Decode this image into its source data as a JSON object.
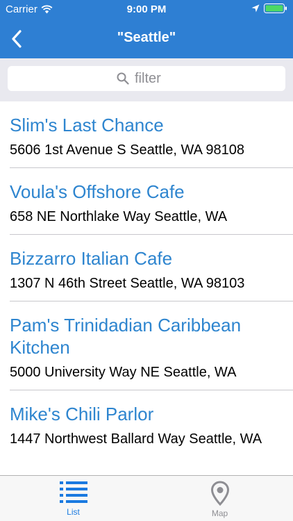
{
  "status_bar": {
    "carrier": "Carrier",
    "time": "9:00 PM"
  },
  "nav": {
    "title": "\"Seattle\"",
    "back_icon": "chevron-left-icon"
  },
  "search": {
    "placeholder": "filter"
  },
  "restaurants": [
    {
      "name": "Slim's Last Chance",
      "address": "5606 1st Avenue S Seattle, WA 98108"
    },
    {
      "name": "Voula's Offshore Cafe",
      "address": "658 NE Northlake Way Seattle, WA"
    },
    {
      "name": "Bizzarro Italian Cafe",
      "address": "1307 N 46th Street Seattle, WA 98103"
    },
    {
      "name": "Pam's Trinidadian Caribbean Kitchen",
      "address": "5000 University Way NE Seattle, WA"
    },
    {
      "name": "Mike's Chili Parlor",
      "address": "1447 Northwest Ballard Way Seattle, WA"
    }
  ],
  "tabbar": {
    "list_label": "List",
    "map_label": "Map"
  },
  "colors": {
    "header_blue": "#2e7fd3",
    "link_blue": "#2e85cf",
    "tab_active": "#1a7ae0",
    "battery_green": "#4cd964"
  }
}
